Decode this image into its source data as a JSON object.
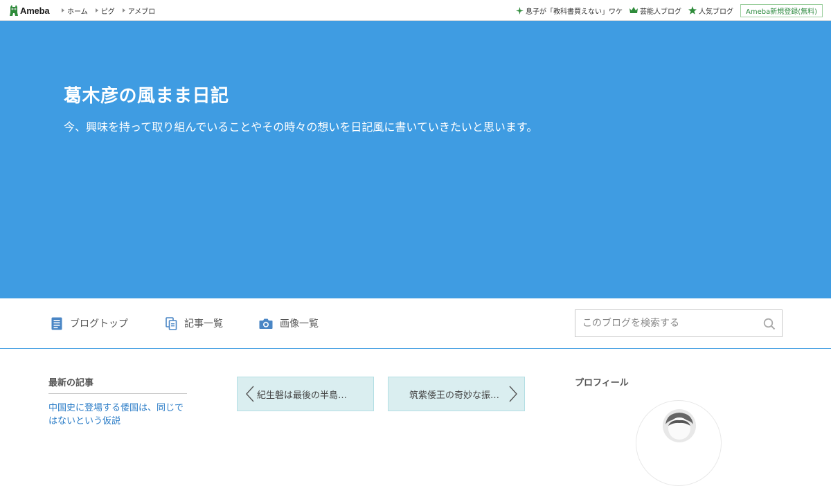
{
  "global_header": {
    "logo_text": "Ameba",
    "left_nav": [
      "ホーム",
      "ピグ",
      "アメブロ"
    ],
    "right_nav": [
      {
        "label": "息子が「教科書買えない」ワケ",
        "icon": "sparkle-icon"
      },
      {
        "label": "芸能人ブログ",
        "icon": "crown-icon"
      },
      {
        "label": "人気ブログ",
        "icon": "star-icon"
      }
    ],
    "register_label": "Ameba新規登録(無料)"
  },
  "blog": {
    "title": "葛木彦の風まま日記",
    "description": "今、興味を持って取り組んでいることやその時々の想いを日記風に書いていきたいと思います。"
  },
  "blog_nav": {
    "items": [
      {
        "label": "ブログトップ",
        "icon": "document-icon"
      },
      {
        "label": "記事一覧",
        "icon": "copy-icon"
      },
      {
        "label": "画像一覧",
        "icon": "camera-icon"
      }
    ],
    "search_placeholder": "このブログを検索する"
  },
  "sidebar": {
    "latest_title": "最新の記事",
    "latest_items": [
      "中国史に登場する倭国は、同じではないという仮説"
    ]
  },
  "pager": {
    "prev_label": "紀生磐は最後の半島…",
    "next_label": "筑紫倭王の奇妙な振…"
  },
  "profile": {
    "title": "プロフィール"
  },
  "colors": {
    "hero": "#3f9ce2",
    "link": "#2a7cc7",
    "pager_bg": "#daeef0",
    "brand_green": "#2b8a3e"
  }
}
